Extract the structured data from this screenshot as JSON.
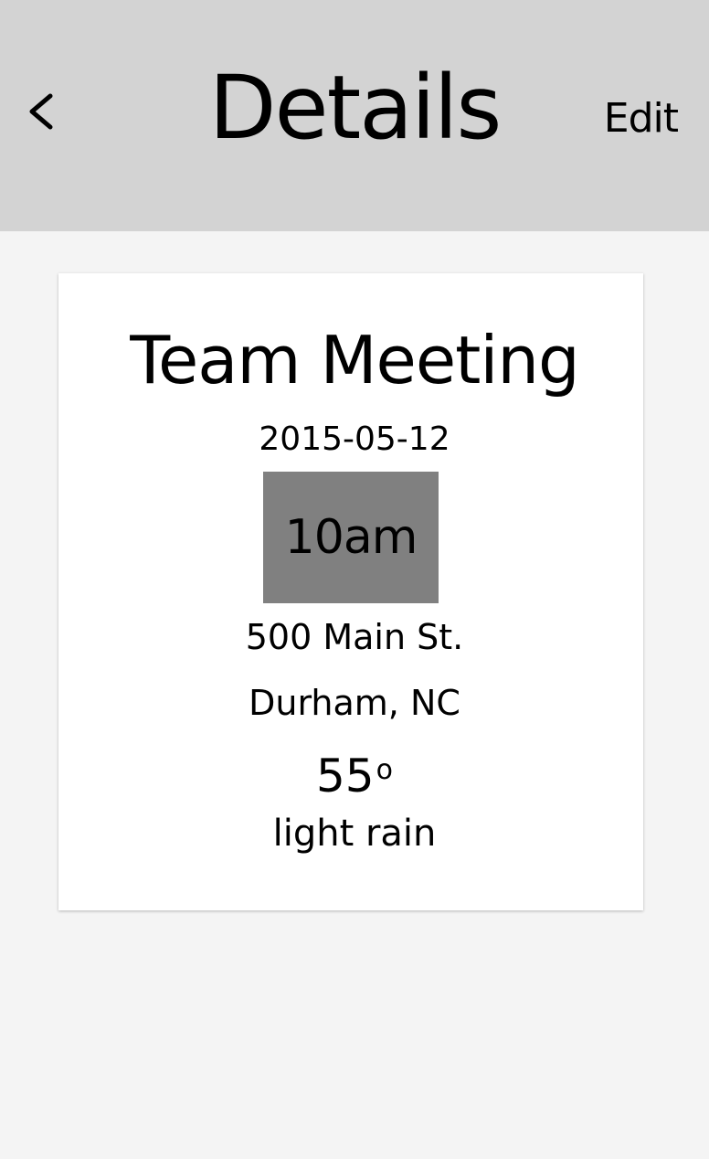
{
  "header": {
    "back_icon": "chevron-left-icon",
    "title": "Details",
    "edit_label": "Edit",
    "background": "#d3d3d3"
  },
  "event": {
    "name": "Team Meeting",
    "date": "2015-05-12",
    "time": "10am",
    "time_box_color": "#808080",
    "address": "500 Main St.",
    "city": "Durham, NC",
    "temperature": "55",
    "temperature_unit": "o",
    "weather": "light rain"
  }
}
